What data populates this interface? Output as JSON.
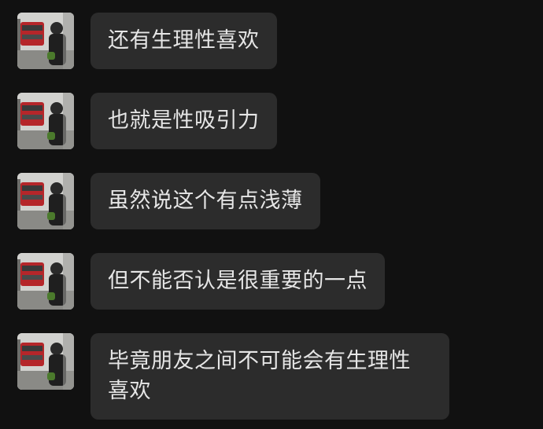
{
  "colors": {
    "background": "#111111",
    "bubble": "#2c2c2c",
    "text": "#e6e6e6"
  },
  "messages": [
    {
      "text": "还有生理性喜欢"
    },
    {
      "text": "也就是性吸引力"
    },
    {
      "text": "虽然说这个有点浅薄"
    },
    {
      "text": "但不能否认是很重要的一点"
    },
    {
      "text": "毕竟朋友之间不可能会有生理性喜欢"
    }
  ],
  "avatar_icon": "avatar-photo-icon"
}
